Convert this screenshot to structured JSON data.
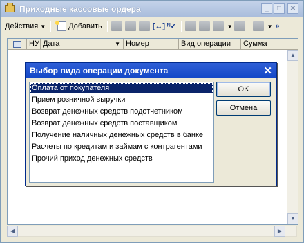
{
  "window": {
    "title": "Приходные кассовые ордера",
    "controls": [
      "minimize",
      "maximize",
      "close"
    ]
  },
  "toolbar": {
    "actions_label": "Действия",
    "add_label": "Добавить"
  },
  "grid": {
    "columns": [
      "НУ",
      "Дата",
      "Номер",
      "Вид операции",
      "Сумма"
    ]
  },
  "dialog": {
    "title": "Выбор вида операции документа",
    "options": [
      "Оплата от покупателя",
      "Прием розничной выручки",
      "Возврат денежных средств подотчетником",
      "Возврат денежных средств поставщиком",
      "Получение наличных денежных средств в банке",
      "Расчеты по кредитам и займам с контрагентами",
      "Прочий приход денежных средств"
    ],
    "selected_index": 0,
    "ok_label": "OK",
    "cancel_label": "Отмена"
  },
  "colors": {
    "dialog_title_bg": "#1347c7",
    "selection_bg": "#0a246a",
    "window_bg": "#ece9d8"
  }
}
